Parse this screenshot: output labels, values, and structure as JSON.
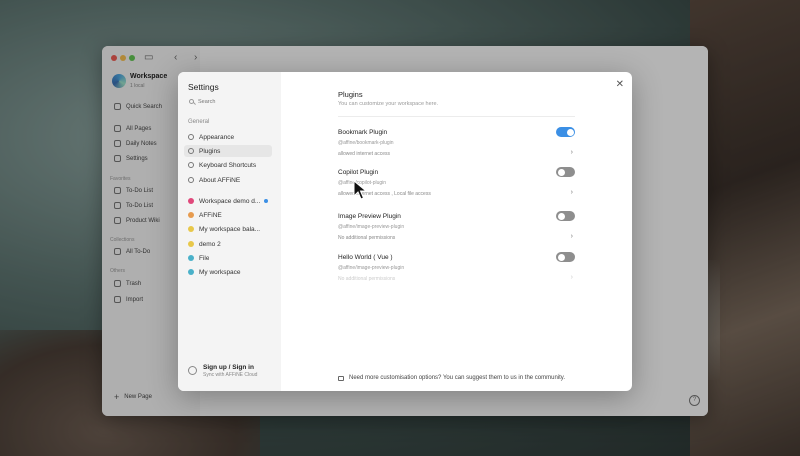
{
  "app": {
    "workspace_name": "Workspace",
    "workspace_sub": "1 local",
    "quick_search": "Quick Search",
    "nav": [
      "All Pages",
      "Daily Notes",
      "Settings"
    ],
    "favorites_head": "Favorites",
    "favorites": [
      "To-Do List",
      "To-Do List",
      "Product Wiki"
    ],
    "collections_head": "Collections",
    "collections": [
      "All To-Do"
    ],
    "others_head": "Others",
    "others": [
      "Trash",
      "Import"
    ],
    "new_page": "New Page"
  },
  "settings": {
    "title": "Settings",
    "search_placeholder": "Search",
    "general_label": "General",
    "nav": [
      {
        "label": "Appearance"
      },
      {
        "label": "Plugins"
      },
      {
        "label": "Keyboard Shortcuts"
      },
      {
        "label": "About AFFiNE"
      }
    ],
    "workspaces": [
      {
        "label": "Workspace demo d...",
        "color": "#e0487b"
      },
      {
        "label": "AFFiNE",
        "color": "#e79b4e"
      },
      {
        "label": "My workspace bala...",
        "color": "#e8c84a"
      },
      {
        "label": "demo 2",
        "color": "#e8c84a"
      },
      {
        "label": "File",
        "color": "#4ab1c9"
      },
      {
        "label": "My workspace",
        "color": "#4ab1c9"
      }
    ],
    "signin_title": "Sign up / Sign in",
    "signin_sub": "Sync with AFFiNE Cloud"
  },
  "plugins": {
    "title": "Plugins",
    "subtitle": "You can customize your workspace here.",
    "items": [
      {
        "name": "Bookmark Plugin",
        "package": "@affine/bookmark-plugin",
        "permissions": "allowed internet access",
        "enabled": true
      },
      {
        "name": "Copilot Plugin",
        "package": "@affine/copilot-plugin",
        "permissions": "allowed internet access , Local file access",
        "enabled": false
      },
      {
        "name": "Image Preview Plugin",
        "package": "@affine/image-preview-plugin",
        "permissions": "No additional permissions",
        "enabled": false
      },
      {
        "name": "Hello World ( Vue )",
        "package": "@affine/image-preview-plugin",
        "permissions": "No additional permissions",
        "enabled": false
      }
    ],
    "footer": "Need more customisation options? You can suggest them to us in the community."
  }
}
